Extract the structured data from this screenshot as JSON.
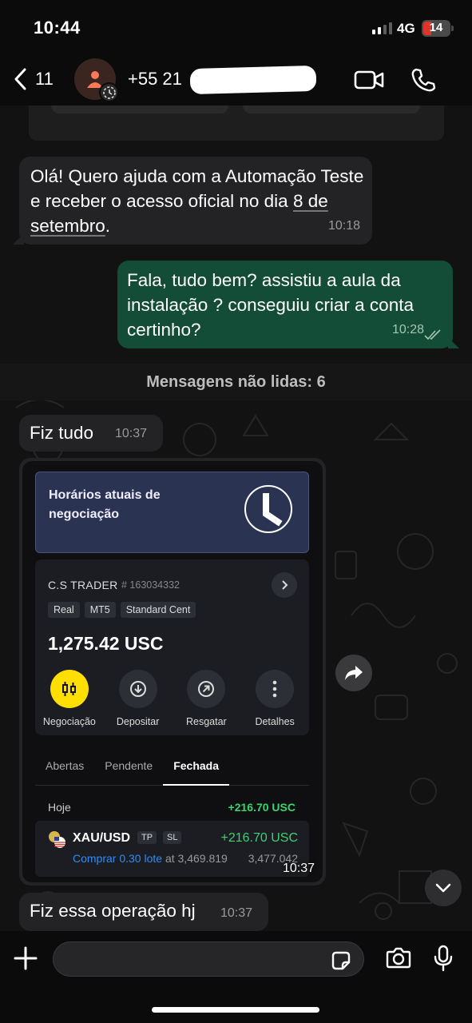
{
  "status_bar": {
    "time": "10:44",
    "network": "4G",
    "battery": "14"
  },
  "header": {
    "back_count": "11",
    "contact_name": "+55 21"
  },
  "messages": {
    "m1": {
      "text_before": "Olá! Quero ajuda com a Automação Teste e receber o acesso oficial no dia ",
      "text_link": "8 de setembro",
      "text_after": ".",
      "time": "10:18"
    },
    "m2": {
      "text": "Fala, tudo bem? assistiu a aula da instalação ? conseguiu criar a conta certinho?",
      "time": "10:28"
    },
    "unread": "Mensagens não lidas: 6",
    "m3": {
      "text": "Fiz tudo",
      "time": "10:37"
    },
    "m4": {
      "text": "Fiz essa operação hj",
      "time": "10:37"
    }
  },
  "image_message": {
    "time": "10:37",
    "banner": "Horários atuais de negociação",
    "account": {
      "name": "C.S TRADER",
      "number": "# 163034332",
      "chips": [
        "Real",
        "MT5",
        "Standard Cent"
      ],
      "balance": "1,275.42 USC",
      "actions": [
        "Negociação",
        "Depositar",
        "Resgatar",
        "Detalhes"
      ]
    },
    "tabs": [
      "Abertas",
      "Pendente",
      "Fechada"
    ],
    "active_tab": "Fechada",
    "day_label": "Hoje",
    "day_profit": "+216.70 USC",
    "trade": {
      "symbol": "XAU/USD",
      "tags": [
        "TP",
        "SL"
      ],
      "profit": "+216.70 USC",
      "action": "Comprar 0.30 lote",
      "open_price": " at 3,469.819",
      "close_price": "3,477.042"
    }
  },
  "input": {
    "placeholder": ""
  },
  "colors": {
    "outgoing": "#144d37",
    "incoming": "#232325",
    "profit_green": "#3bd36e",
    "link_blue": "#2f8cf4",
    "accent_yellow": "#ffde02"
  }
}
